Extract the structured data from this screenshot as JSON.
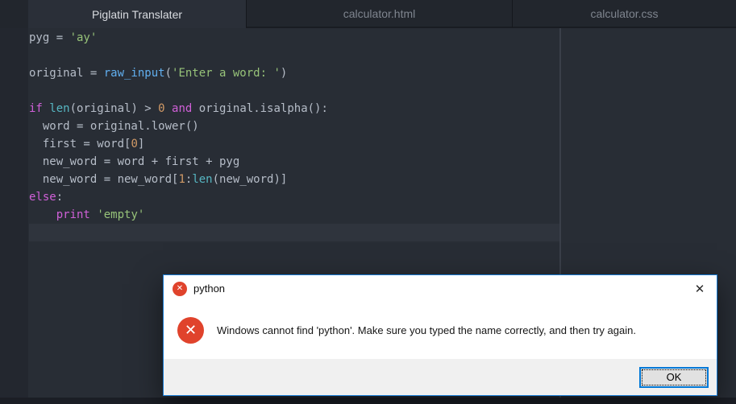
{
  "tabs": [
    {
      "label": "Piglatin Translater",
      "active": true
    },
    {
      "label": "calculator.html",
      "active": false
    },
    {
      "label": "calculator.css",
      "active": false
    }
  ],
  "editor": {
    "palette": {
      "default": "#b6bdc8",
      "keyword": "#d060d8",
      "builtin": "#56b6c2",
      "func": "#61afef",
      "string": "#97c379",
      "number": "#d19a66"
    },
    "code_lines": [
      {
        "tokens": [
          {
            "t": "pyg = ",
            "c": "default"
          },
          {
            "t": "'ay'",
            "c": "string"
          }
        ]
      },
      {
        "tokens": []
      },
      {
        "tokens": [
          {
            "t": "original = ",
            "c": "default"
          },
          {
            "t": "raw_input",
            "c": "func"
          },
          {
            "t": "(",
            "c": "default"
          },
          {
            "t": "'Enter a word: '",
            "c": "string"
          },
          {
            "t": ")",
            "c": "default"
          }
        ]
      },
      {
        "tokens": []
      },
      {
        "tokens": [
          {
            "t": "if ",
            "c": "keyword"
          },
          {
            "t": "len",
            "c": "builtin"
          },
          {
            "t": "(original) > ",
            "c": "default"
          },
          {
            "t": "0",
            "c": "number"
          },
          {
            "t": " ",
            "c": "default"
          },
          {
            "t": "and",
            "c": "keyword"
          },
          {
            "t": " original.isalpha():",
            "c": "default"
          }
        ]
      },
      {
        "tokens": [
          {
            "t": "  word = original.lower()",
            "c": "default"
          }
        ]
      },
      {
        "tokens": [
          {
            "t": "  first = word[",
            "c": "default"
          },
          {
            "t": "0",
            "c": "number"
          },
          {
            "t": "]",
            "c": "default"
          }
        ]
      },
      {
        "tokens": [
          {
            "t": "  new_word = word + first + pyg",
            "c": "default"
          }
        ]
      },
      {
        "tokens": [
          {
            "t": "  new_word = new_word[",
            "c": "default"
          },
          {
            "t": "1",
            "c": "number"
          },
          {
            "t": ":",
            "c": "default"
          },
          {
            "t": "len",
            "c": "builtin"
          },
          {
            "t": "(new_word)]",
            "c": "default"
          }
        ]
      },
      {
        "tokens": [
          {
            "t": "else",
            "c": "keyword"
          },
          {
            "t": ":",
            "c": "default"
          }
        ]
      },
      {
        "tokens": [
          {
            "t": "    ",
            "c": "default"
          },
          {
            "t": "print",
            "c": "keyword"
          },
          {
            "t": " ",
            "c": "default"
          },
          {
            "t": "'empty'",
            "c": "string"
          }
        ]
      },
      {
        "tokens": [],
        "highlight": true
      }
    ]
  },
  "dialog": {
    "title": "python",
    "message": "Windows cannot find 'python'. Make sure you typed the name correctly, and then try again.",
    "ok_label": "OK",
    "close_glyph": "✕",
    "error_icon_glyph": "✕",
    "accent_border": "#1679d2",
    "error_color": "#e0432c",
    "button_focus_border": "#0078d7"
  }
}
